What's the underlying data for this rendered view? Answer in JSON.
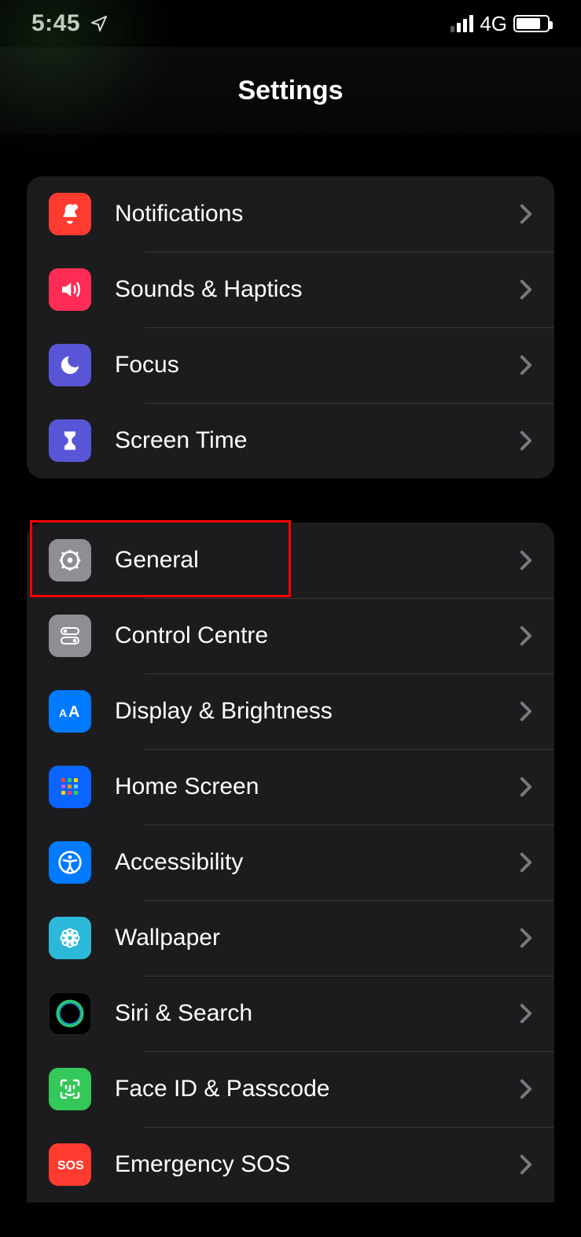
{
  "status": {
    "time": "5:45",
    "network_type": "4G"
  },
  "header": {
    "title": "Settings"
  },
  "sections": [
    {
      "rows": [
        {
          "label": "Notifications"
        },
        {
          "label": "Sounds & Haptics"
        },
        {
          "label": "Focus"
        },
        {
          "label": "Screen Time"
        }
      ]
    },
    {
      "rows": [
        {
          "label": "General"
        },
        {
          "label": "Control Centre"
        },
        {
          "label": "Display & Brightness"
        },
        {
          "label": "Home Screen"
        },
        {
          "label": "Accessibility"
        },
        {
          "label": "Wallpaper"
        },
        {
          "label": "Siri & Search"
        },
        {
          "label": "Face ID & Passcode"
        },
        {
          "label": "Emergency SOS"
        }
      ]
    }
  ],
  "annotation": {
    "highlighted_row": "General"
  }
}
